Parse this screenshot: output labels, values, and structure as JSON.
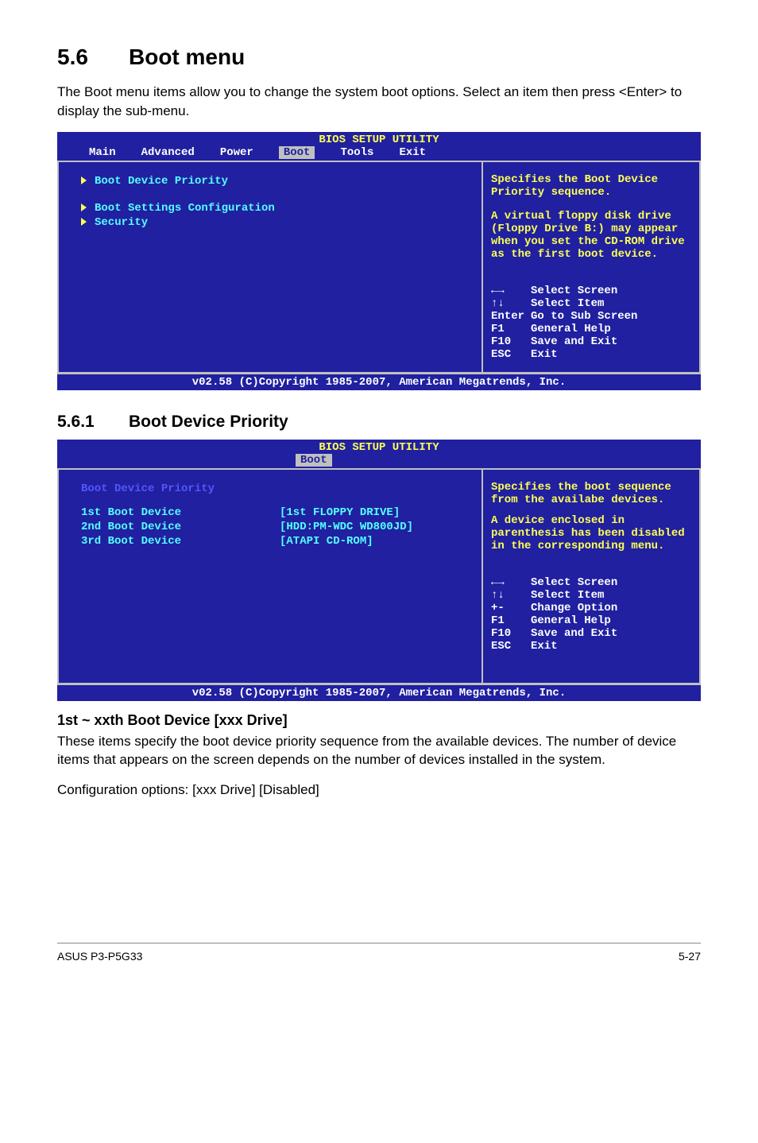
{
  "section": {
    "num": "5.6",
    "title": "Boot menu"
  },
  "intro_p": "The Boot menu items allow you to change the system boot options. Select an item then press <Enter> to display the sub-menu.",
  "bios1": {
    "title": "BIOS SETUP UTILITY",
    "menu": {
      "items": [
        "Main",
        "Advanced",
        "Power",
        "Boot",
        "Tools",
        "Exit"
      ],
      "active": "Boot"
    },
    "left": {
      "l1": "Boot Device Priority",
      "l2": "Boot Settings Configuration",
      "l3": "Security"
    },
    "right": {
      "help1": "Specifies the Boot Device Priority sequence.",
      "help2": "A virtual floppy disk drive (Floppy Drive B:) may appear when you set the CD-ROM drive as the first boot device.",
      "keys": {
        "k1": {
          "key": "←→",
          "txt": "Select Screen"
        },
        "k2": {
          "key": "↑↓",
          "txt": "Select Item"
        },
        "k3": {
          "key": "Enter",
          "txt": "Go to Sub Screen"
        },
        "k4": {
          "key": "F1",
          "txt": "General Help"
        },
        "k5": {
          "key": "F10",
          "txt": "Save and Exit"
        },
        "k6": {
          "key": "ESC",
          "txt": "Exit"
        }
      }
    },
    "footer": "v02.58 (C)Copyright 1985-2007, American Megatrends, Inc."
  },
  "subsection": {
    "num": "5.6.1",
    "title": "Boot Device Priority"
  },
  "bios2": {
    "title": "BIOS SETUP UTILITY",
    "menu": {
      "active": "Boot"
    },
    "left": {
      "heading": "Boot Device Priority",
      "r1": {
        "label": "1st Boot Device",
        "val": "[1st FLOPPY DRIVE]"
      },
      "r2": {
        "label": "2nd Boot Device",
        "val": "[HDD:PM-WDC WD800JD]"
      },
      "r3": {
        "label": "3rd Boot Device",
        "val": "[ATAPI CD-ROM]"
      }
    },
    "right": {
      "help": "Specifies the boot sequence from the availabe devices.",
      "help2": "A device enclosed in parenthesis has been disabled in the corresponding menu.",
      "keys": {
        "k1": {
          "key": "←→",
          "txt": "Select Screen"
        },
        "k2": {
          "key": "↑↓",
          "txt": "Select Item"
        },
        "k3": {
          "key": "+-",
          "txt": "Change Option"
        },
        "k4": {
          "key": "F1",
          "txt": "General Help"
        },
        "k5": {
          "key": "F10",
          "txt": "Save and Exit"
        },
        "k6": {
          "key": "ESC",
          "txt": "Exit"
        }
      }
    },
    "footer": "v02.58 (C)Copyright 1985-2007, American Megatrends, Inc."
  },
  "para_h": "1st ~ xxth Boot Device [xxx Drive]",
  "para_body1": "These items specify the boot device priority sequence from the available devices. The number of device items that appears on the screen depends on the number of devices installed in the system.",
  "para_body2": "Configuration options: [xxx Drive] [Disabled]",
  "footer": {
    "product": "ASUS P3-P5G33",
    "page": "5-27"
  }
}
